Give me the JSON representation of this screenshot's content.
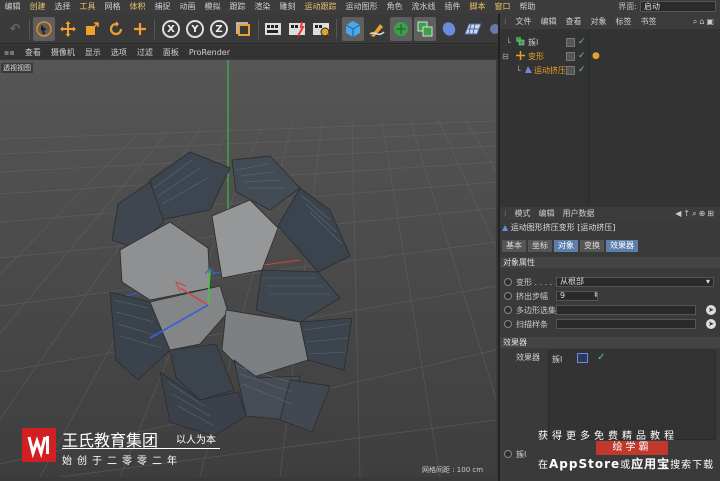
{
  "menubar": {
    "items": [
      "编辑",
      "创建",
      "选择",
      "工具",
      "网格",
      "体积",
      "捕捉",
      "动画",
      "模拟",
      "跟踪",
      "渲染",
      "雕刻",
      "运动跟踪",
      "运动图形",
      "角色",
      "流水线",
      "插件",
      "脚本",
      "窗口",
      "帮助"
    ],
    "interface_label": "界面:",
    "interface_value": "启动"
  },
  "toolbar": {
    "axis_x": "X",
    "axis_y": "Y",
    "axis_z": "Z"
  },
  "viewport_menu": [
    "查看",
    "摄像机",
    "显示",
    "选项",
    "过滤",
    "面板",
    "ProRender"
  ],
  "viewport": {
    "label": "透视视图",
    "grid_readout": "网格间距 : 100 cm"
  },
  "object_manager": {
    "menu": [
      "文件",
      "编辑",
      "查看",
      "对象",
      "标签",
      "书签"
    ],
    "rows": [
      {
        "name": "簇Ⅰ",
        "color": "#cfcfcf"
      },
      {
        "name": "变形",
        "color": "#e8a030"
      },
      {
        "name": "运动挤压",
        "color": "#e8a030"
      }
    ]
  },
  "attribute_manager": {
    "menu": [
      "模式",
      "编辑",
      "用户数据"
    ],
    "title": "运动图形挤压变形 [运动挤压]",
    "tabs": [
      {
        "label": "基本",
        "active": false
      },
      {
        "label": "坐标",
        "active": false
      },
      {
        "label": "对象",
        "active": true
      },
      {
        "label": "变换",
        "active": false
      },
      {
        "label": "效果器",
        "active": true
      }
    ],
    "section_object": "对象属性",
    "props": [
      {
        "label": "变形",
        "value": "从根部"
      },
      {
        "label": "挤出步幅",
        "value": "9"
      },
      {
        "label": "多边形选集",
        "value": ""
      },
      {
        "label": "扫描样条",
        "value": ""
      }
    ],
    "section_effector": "效果器",
    "effector_label": "效果器",
    "effector_item": "簇Ⅰ",
    "bottom_item": "簇Ⅰ"
  },
  "watermark": {
    "brand": "王氏教育集团",
    "slogan": "以人为本",
    "sub": "始创于二零零二年",
    "promo_line1": "获得更多免费精品教程",
    "promo_badge": "绘学霸",
    "promo_line3_a": "在",
    "promo_line3_b": "AppStore",
    "promo_line3_c": "或",
    "promo_line3_d": "应用宝",
    "promo_line3_e": "搜索下载"
  }
}
